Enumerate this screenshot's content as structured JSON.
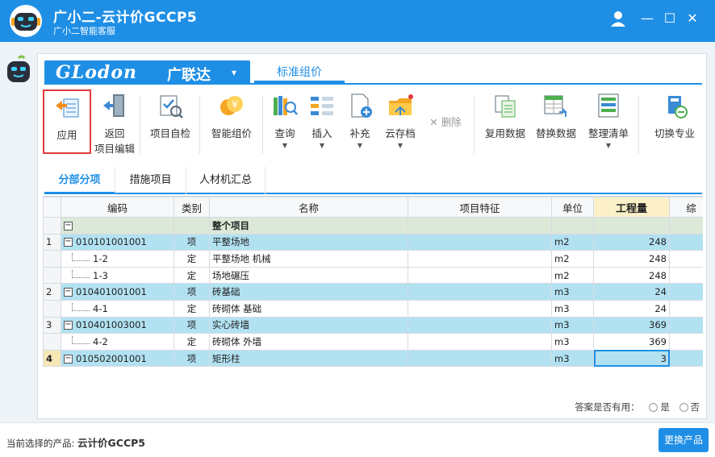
{
  "window": {
    "title": "广小二-云计价GCCP5",
    "subtitle": "广小二智能客服",
    "controls": {
      "user_icon": "user-icon",
      "minimize": "—",
      "maximize": "☐",
      "close": "✕"
    }
  },
  "brand": {
    "logo_text": "GLodon",
    "logo_cn": "广联达",
    "dropdown": "▾",
    "mode_tab": "标准组价"
  },
  "toolbar": {
    "apply": "应用",
    "back_line1": "返回",
    "back_line2": "项目编辑",
    "self_check": "项目自检",
    "smart_price": "智能组价",
    "query": "查询",
    "insert": "插入",
    "supplement": "补充",
    "cloud_save": "云存档",
    "delete": "删除",
    "reuse_data": "复用数据",
    "replace_data": "替换数据",
    "organize_list": "整理清单",
    "switch_major": "切换专业"
  },
  "subtabs": [
    "分部分项",
    "措施项目",
    "人材机汇总"
  ],
  "grid": {
    "columns": [
      "",
      "编码",
      "类别",
      "名称",
      "项目特征",
      "单位",
      "工程量",
      "综"
    ],
    "rows": [
      {
        "no": "",
        "code": "",
        "type": "",
        "name": "整个项目",
        "feature": "",
        "unit": "",
        "qty": ""
      },
      {
        "no": "1",
        "code": "010101001001",
        "type": "项",
        "name": "平整场地",
        "feature": "",
        "unit": "m2",
        "qty": "248"
      },
      {
        "no": "",
        "code": "1-2",
        "type": "定",
        "name": "平整场地 机械",
        "feature": "",
        "unit": "m2",
        "qty": "248"
      },
      {
        "no": "",
        "code": "1-3",
        "type": "定",
        "name": "场地碾压",
        "feature": "",
        "unit": "m2",
        "qty": "248"
      },
      {
        "no": "2",
        "code": "010401001001",
        "type": "项",
        "name": "砖基础",
        "feature": "",
        "unit": "m3",
        "qty": "24"
      },
      {
        "no": "",
        "code": "4-1",
        "type": "定",
        "name": "砖砌体 基础",
        "feature": "",
        "unit": "m3",
        "qty": "24"
      },
      {
        "no": "3",
        "code": "010401003001",
        "type": "项",
        "name": "实心砖墙",
        "feature": "",
        "unit": "m3",
        "qty": "369"
      },
      {
        "no": "",
        "code": "4-2",
        "type": "定",
        "name": "砖砌体 外墙",
        "feature": "",
        "unit": "m3",
        "qty": "369"
      },
      {
        "no": "4",
        "code": "010502001001",
        "type": "项",
        "name": "矩形柱",
        "feature": "",
        "unit": "m3",
        "qty": "3"
      }
    ]
  },
  "feedback": {
    "question": "答案是否有用：",
    "yes": "是",
    "no": "否"
  },
  "footer": {
    "label": "当前选择的产品:",
    "product": "云计价GCCP5",
    "change_button": "更换产品"
  },
  "colors": {
    "accent": "#1f8fe6",
    "row_qd": "#b2e2f2",
    "row_root": "#dce9d8",
    "highlight": "#e23b3b"
  }
}
